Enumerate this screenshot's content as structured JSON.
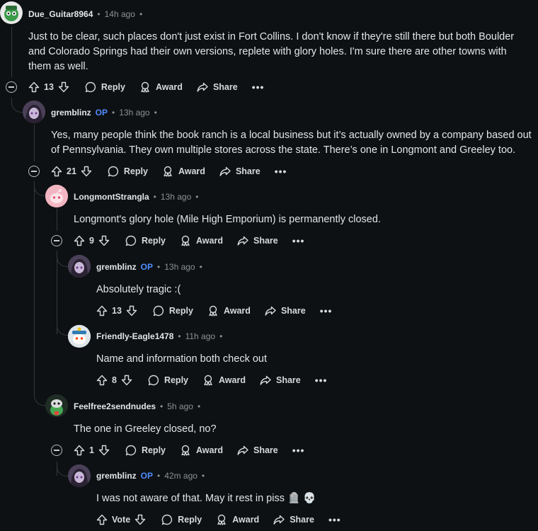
{
  "comments": [
    {
      "author": "Due_Guitar8964",
      "op": "",
      "time": "14h ago",
      "body": "Just to be clear, such places don't just exist in Fort Collins. I don't know if they're still there but both Boulder and Colorado Springs had their own versions, replete with glory holes. I'm sure there are other towns with them as well.",
      "votes": "13"
    },
    {
      "author": "gremblinz",
      "op": "OP",
      "time": "13h ago",
      "body": "Yes, many people think the book ranch is a local business but it’s actually owned by a company based out of Pennsylvania. They own multiple stores across the state. There’s one in Longmont and Greeley too.",
      "votes": "21"
    },
    {
      "author": "LongmontStrangla",
      "op": "",
      "time": "13h ago",
      "body": "Longmont's glory hole (Mile High Emporium) is permanently closed.",
      "votes": "9"
    },
    {
      "author": "gremblinz",
      "op": "OP",
      "time": "13h ago",
      "body": "Absolutely tragic :(",
      "votes": "13"
    },
    {
      "author": "Friendly-Eagle1478",
      "op": "",
      "time": "11h ago",
      "body": "Name and information both check out",
      "votes": "8"
    },
    {
      "author": "Feelfree2sendnudes",
      "op": "",
      "time": "5h ago",
      "body": "The one in Greeley closed, no?",
      "votes": "1"
    },
    {
      "author": "gremblinz",
      "op": "OP",
      "time": "42m ago",
      "body": "I was not aware of that. May it rest in piss 🪦 💀",
      "votes": "Vote"
    }
  ],
  "labels": {
    "reply": "Reply",
    "award": "Award",
    "share": "Share",
    "more": "•••",
    "separator": "•"
  },
  "colors": {
    "background": "#0e1113",
    "op": "#4f8cff",
    "text": "#e3e6e8",
    "muted": "#8b9194"
  },
  "icons": [
    "upvote-icon",
    "downvote-icon",
    "comment-icon",
    "award-icon",
    "share-icon",
    "collapse-icon",
    "overflow-icon"
  ]
}
